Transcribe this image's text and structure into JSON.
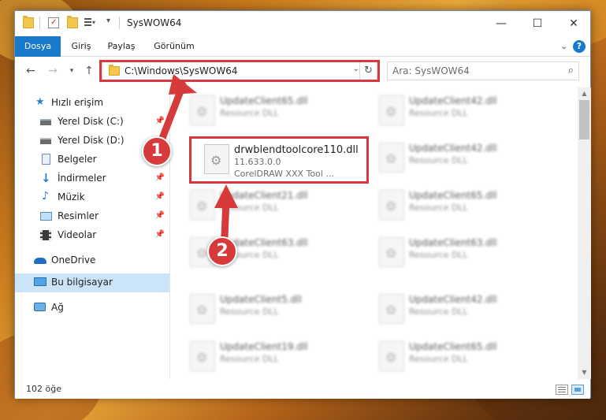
{
  "window": {
    "title": "SysWOW64",
    "controls": {
      "minimize": "—",
      "maximize": "☐",
      "close": "✕"
    }
  },
  "ribbon": {
    "tabs": [
      {
        "label": "Dosya",
        "active": true
      },
      {
        "label": "Giriş",
        "active": false
      },
      {
        "label": "Paylaş",
        "active": false
      },
      {
        "label": "Görünüm",
        "active": false
      }
    ],
    "help": "?"
  },
  "navigation": {
    "address_path": "C:\\Windows\\SysWOW64",
    "search_placeholder": "Ara: SysWOW64"
  },
  "sidebar": {
    "items": [
      {
        "label": "Hızlı erişim",
        "icon": "star-icon"
      },
      {
        "label": "Yerel Disk (C:)",
        "icon": "drive-icon",
        "pinned": true
      },
      {
        "label": "Yerel Disk (D:)",
        "icon": "drive-icon",
        "pinned": false
      },
      {
        "label": "Belgeler",
        "icon": "documents-icon",
        "pinned": true
      },
      {
        "label": "İndirmeler",
        "icon": "download-icon",
        "pinned": true
      },
      {
        "label": "Müzik",
        "icon": "music-icon",
        "pinned": true
      },
      {
        "label": "Resimler",
        "icon": "pictures-icon",
        "pinned": true
      },
      {
        "label": "Videolar",
        "icon": "video-icon",
        "pinned": true
      },
      {
        "label": "OneDrive",
        "icon": "cloud-icon"
      },
      {
        "label": "Bu bilgisayar",
        "icon": "computer-icon",
        "selected": true
      },
      {
        "label": "Ağ",
        "icon": "network-icon"
      }
    ]
  },
  "files": {
    "highlighted": {
      "name": "drwblendtoolcore110.dll",
      "version": "11.633.0.0",
      "description": "CorelDRAW XXX Tool ..."
    },
    "left_column": [
      {
        "name": "UpdateClient65.dll",
        "type": "Resource DLL"
      },
      {
        "name": "UpdateClient21.dll",
        "type": "Resource DLL"
      },
      {
        "name": "UpdateClient63.dll",
        "type": "Resource DLL"
      },
      {
        "name": "UpdateClient5.dll",
        "type": "Resource DLL"
      },
      {
        "name": "UpdateClient19.dll",
        "type": "Resource DLL"
      }
    ],
    "right_column": [
      {
        "name": "UpdateClient42.dll",
        "type": "Resource DLL"
      },
      {
        "name": "UpdateClient42.dll",
        "type": "Resource DLL"
      },
      {
        "name": "UpdateClient65.dll",
        "type": "Resource DLL"
      },
      {
        "name": "UpdateClient63.dll",
        "type": "Resource DLL"
      },
      {
        "name": "UpdateClient42.dll",
        "type": "Resource DLL"
      },
      {
        "name": "UpdateClient65.dll",
        "type": "Resource DLL"
      }
    ]
  },
  "status": {
    "item_count": "102 öğe"
  },
  "callouts": {
    "one": "1",
    "two": "2"
  },
  "colors": {
    "accent": "#1979ca",
    "highlight_border": "#d9363e",
    "callout": "#d63a3a",
    "selected_bg": "#cce4f7"
  }
}
